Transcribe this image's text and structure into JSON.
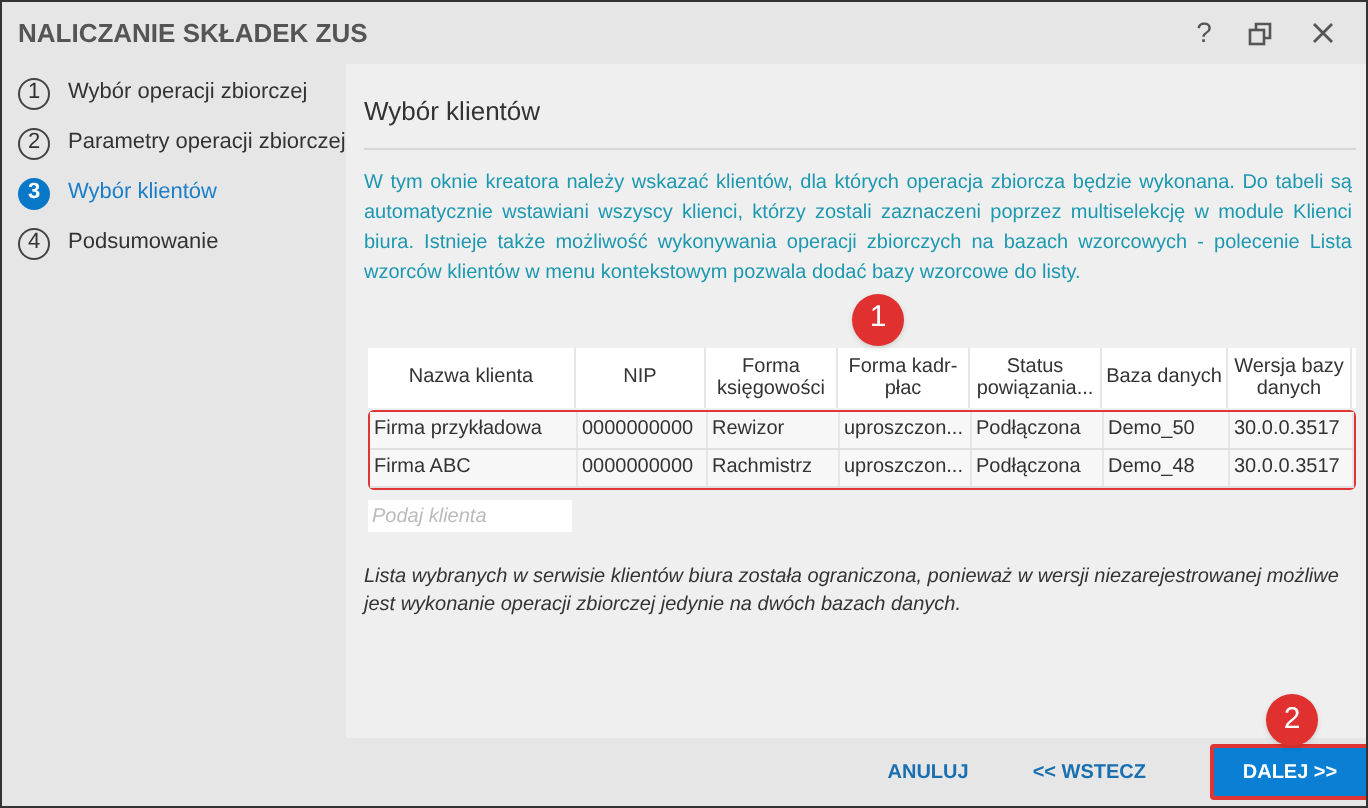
{
  "window": {
    "title": "NALICZANIE SKŁADEK ZUS",
    "help": "?"
  },
  "steps": [
    {
      "number": "1",
      "label": "Wybór operacji zbiorczej",
      "selected": false
    },
    {
      "number": "2",
      "label": "Parametry operacji zbiorczej",
      "selected": false
    },
    {
      "number": "3",
      "label": "Wybór klientów",
      "selected": true
    },
    {
      "number": "4",
      "label": "Podsumowanie",
      "selected": false
    }
  ],
  "section_title": "Wybór klientów",
  "intro": "W tym oknie kreatora należy wskazać klientów, dla których operacja zbiorcza będzie wykonana. Do tabeli są automatycznie wstawiani wszyscy klienci, którzy zostali zaznaczeni poprzez multiselekcję w module Klienci biura. Istnieje także możliwość wykonywania operacji zbiorczych na bazach wzorcowych - polecenie Lista wzorców klientów w menu kontekstowym pozwala dodać bazy wzorcowe do listy.",
  "table": {
    "columns": [
      "Nazwa klienta",
      "NIP",
      "Forma księgowości",
      "Forma kadr-płac",
      "Status powiązania...",
      "Baza danych",
      "Wersja bazy danych"
    ],
    "rows": [
      [
        "Firma przykładowa",
        "0000000000",
        "Rewizor",
        "uproszczon...",
        "Podłączona",
        "Demo_50",
        "30.0.0.3517"
      ],
      [
        "Firma ABC",
        "0000000000",
        "Rachmistrz",
        "uproszczon...",
        "Podłączona",
        "Demo_48",
        "30.0.0.3517"
      ]
    ],
    "search": {
      "placeholder": "Podaj klienta"
    }
  },
  "note": "Lista wybranych w serwisie klientów biura została ograniczona, ponieważ w wersji niezarejestrowanej możliwe jest wykonanie operacji zbiorczej jedynie na dwóch bazach danych.",
  "markers": [
    "1",
    "2"
  ],
  "buttons": [
    {
      "label": "ANULUJ",
      "kind": "link"
    },
    {
      "label": "<< WSTECZ",
      "kind": "link"
    },
    {
      "label": "DALEJ >>",
      "kind": "primary"
    }
  ]
}
